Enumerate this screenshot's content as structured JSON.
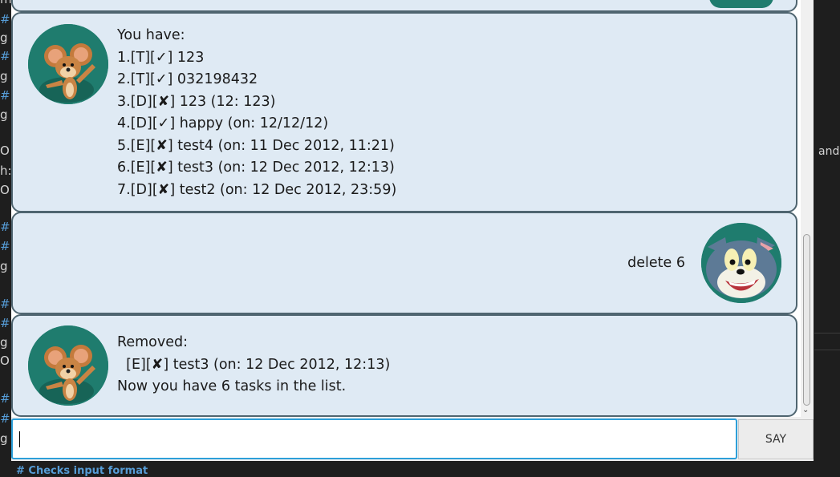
{
  "background_editor": {
    "left_fragments": [
      "m",
      "#",
      "g",
      "#",
      "g",
      "#",
      "g",
      "O",
      "h:",
      "O",
      "#",
      "#",
      "g",
      "#",
      "#",
      "g",
      "O",
      "#",
      "#",
      "g"
    ],
    "right_fragment": "and",
    "bottom_fragment": "# Checks input format"
  },
  "chat": {
    "bot_reply_list": {
      "lines": [
        "You have:",
        "1.[T][✓] 123",
        "2.[T][✓] 032198432",
        "3.[D][✘] 123 (12: 123)",
        "4.[D][✓] happy (on: 12/12/12)",
        "5.[E][✘] test4 (on: 11 Dec 2012, 11:21)",
        "6.[E][✘] test3 (on: 12 Dec 2012, 12:13)",
        "7.[D][✘] test2 (on: 12 Dec 2012, 23:59)"
      ]
    },
    "user_message": "delete 6",
    "bot_reply_removed": {
      "lines": [
        "Removed:",
        "  [E][✘] test3 (on: 12 Dec 2012, 12:13)",
        "Now you have 6 tasks in the list."
      ]
    }
  },
  "input": {
    "value": "",
    "placeholder": ""
  },
  "say_button": {
    "label": "SAY"
  },
  "colors": {
    "bubble_bg": "#dfeaf4",
    "bubble_border": "#4f6570",
    "input_focus": "#2d9fd9",
    "avatar_bg": "#1f7c6e"
  },
  "icons": {
    "bot_avatar": "mouse-avatar-icon",
    "user_avatar": "cat-avatar-icon",
    "scroll_down": "chevron-down-icon"
  }
}
